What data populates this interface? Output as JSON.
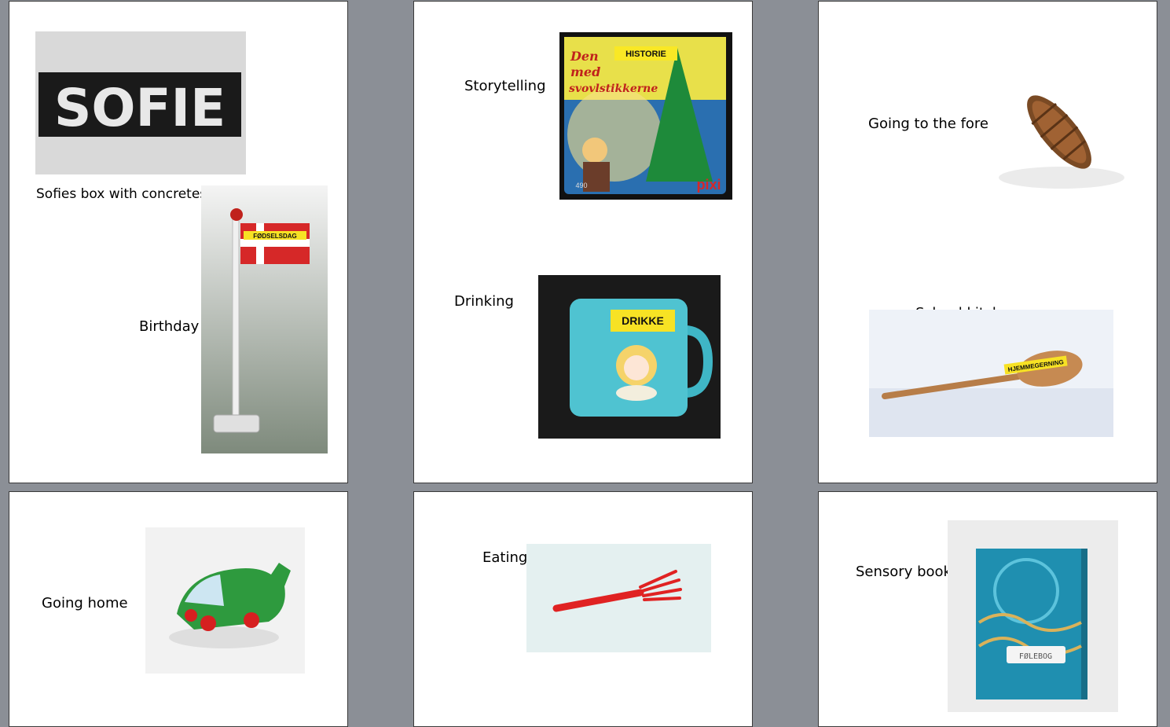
{
  "pages": [
    {
      "items": [
        {
          "label": "Sofies box with concretes",
          "photo_text": "SOFIE",
          "photo_alt": "Sofie name plate"
        },
        {
          "label": "Birthday",
          "photo_text": "FØDSELSDAG",
          "photo_alt": "Danish flag on pole"
        }
      ]
    },
    {
      "items": [
        {
          "label": "Storytelling",
          "photo_text": "HISTORIE",
          "photo_alt": "Pixi book"
        },
        {
          "label": "Drinking",
          "photo_text": "DRIKKE",
          "photo_alt": "Turquoise cup"
        }
      ]
    },
    {
      "items": [
        {
          "label": "Going to the forest",
          "photo_alt": "Pine cone"
        },
        {
          "label": "School kitchen",
          "photo_text": "HJEMMEGERNING",
          "photo_alt": "Wooden spoon"
        }
      ]
    },
    {
      "items": [
        {
          "label": "Going home",
          "photo_alt": "Green toy car"
        }
      ]
    },
    {
      "items": [
        {
          "label": "Eating",
          "photo_alt": "Red plastic fork"
        }
      ]
    },
    {
      "items": [
        {
          "label": "Sensory books",
          "photo_text": "FØLEBOG",
          "photo_alt": "Blue fabric book"
        }
      ]
    }
  ],
  "book_cover_text": {
    "line1": "Den",
    "line2": "med",
    "line3": "svovlstikkerne",
    "brand": "pixi",
    "number": "490"
  }
}
